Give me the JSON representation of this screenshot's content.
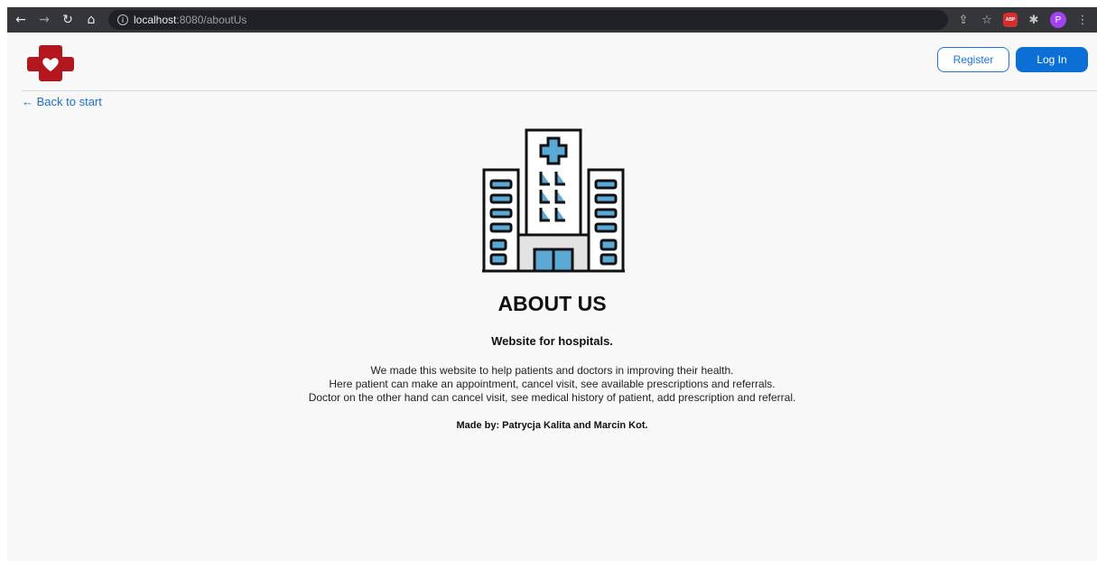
{
  "browser": {
    "url_host": "localhost",
    "url_path": ":8080/aboutUs",
    "profile_initial": "P",
    "abp_label": "ABP"
  },
  "header": {
    "register_label": "Register",
    "login_label": "Log In"
  },
  "nav": {
    "back_label": "← Back to start"
  },
  "about": {
    "title": "ABOUT US",
    "subtitle": "Website for hospitals.",
    "lines": [
      "We made this website to help patients and doctors in improving their health.",
      "Here patient can make an appointment, cancel visit, see available prescriptions and referrals.",
      "Doctor on the other hand can cancel visit, see medical history of patient, add prescription and referral."
    ],
    "credits": "Made by: Patrycja Kalita and Marcin Kot."
  },
  "colors": {
    "brand_red": "#b3171d",
    "primary_blue": "#0b6fd6",
    "window_blue": "#5aa9d6"
  }
}
